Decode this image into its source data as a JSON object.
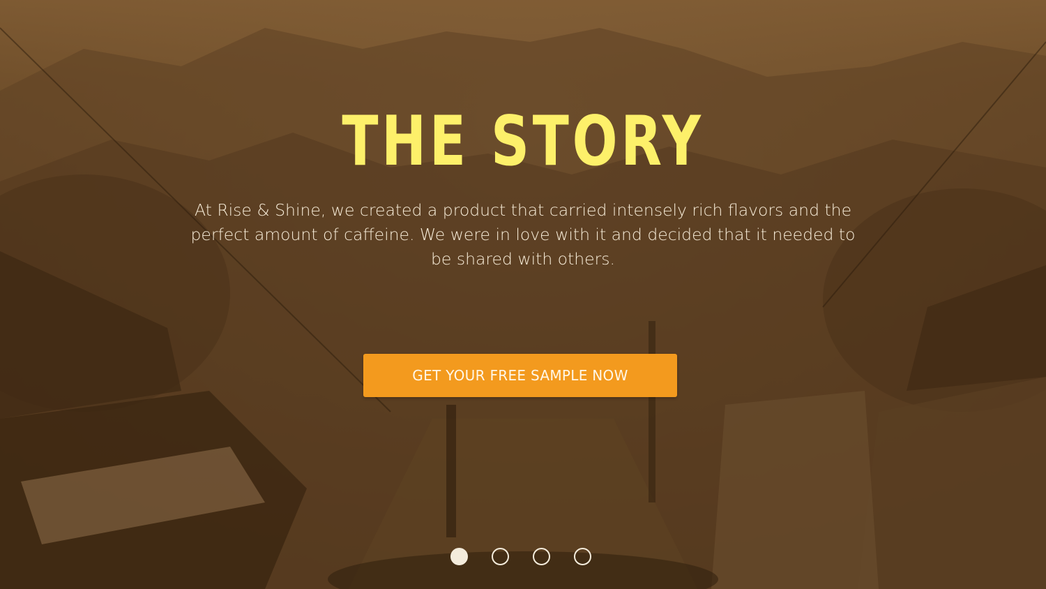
{
  "hero": {
    "title": "THE STORY",
    "description": "At Rise & Shine, we created a product that carried intensely rich flavors and the perfect amount of caffeine. We were in love with it and decided that it needed to be shared with others.",
    "cta_label": "GET YOUR FREE SAMPLE NOW"
  },
  "carousel": {
    "slide_count": 4,
    "active_index": 0
  },
  "colors": {
    "title": "#fdf06a",
    "cta_background": "#f39a1e",
    "overlay": "#7a5630"
  }
}
